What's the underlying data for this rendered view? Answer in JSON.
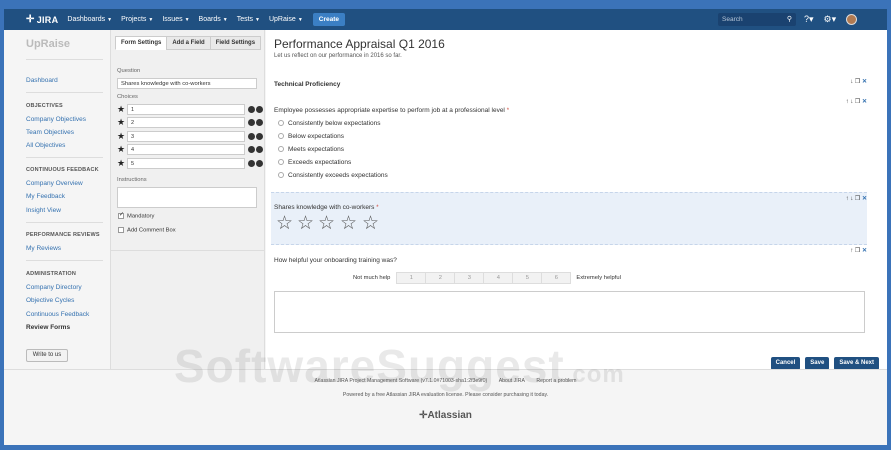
{
  "nav": {
    "logo": "JIRA",
    "items": [
      "Dashboards",
      "Projects",
      "Issues",
      "Boards",
      "Tests",
      "UpRaise"
    ],
    "create": "Create",
    "search_placeholder": "Search"
  },
  "sidebar": {
    "title": "UpRaise",
    "dashboard": "Dashboard",
    "sections": [
      {
        "heading": "OBJECTIVES",
        "items": [
          "Company Objectives",
          "Team Objectives",
          "All Objectives"
        ]
      },
      {
        "heading": "CONTINUOUS FEEDBACK",
        "items": [
          "Company Overview",
          "My Feedback",
          "Insight View"
        ]
      },
      {
        "heading": "PERFORMANCE REVIEWS",
        "items": [
          "My Reviews"
        ]
      },
      {
        "heading": "ADMINISTRATION",
        "items": [
          "Company Directory",
          "Objective Cycles",
          "Continuous Feedback",
          "Review Forms"
        ]
      }
    ],
    "write_button": "Write to us"
  },
  "panel": {
    "tabs": [
      "Form Settings",
      "Add a Field",
      "Field Settings"
    ],
    "question_label": "Question",
    "question_value": "Shares knowledge with co-workers",
    "choices_label": "Choices",
    "choices": [
      "1",
      "2",
      "3",
      "4",
      "5"
    ],
    "instructions_label": "Instructions",
    "mandatory": "Mandatory",
    "comment_box": "Add Comment Box"
  },
  "form": {
    "title": "Performance Appraisal Q1 2016",
    "subtitle": "Let us reflect on our performance in 2016 so far.",
    "section_title": "Technical Proficiency",
    "q1": {
      "text": "Employee possesses appropriate expertise to perform job at a professional level",
      "req": "*",
      "options": [
        "Consistently below expectations",
        "Below expectations",
        "Meets expectations",
        "Exceeds expectations",
        "Consistently exceeds expectations"
      ]
    },
    "q2": {
      "text": "Shares knowledge with co-workers",
      "req": "*"
    },
    "q3": {
      "text": "How helpful your onboarding training was?",
      "low": "Not much help",
      "high": "Extremely helpful",
      "scale": [
        "1",
        "2",
        "3",
        "4",
        "5",
        "6"
      ]
    },
    "buttons": {
      "cancel": "Cancel",
      "save": "Save",
      "save_next": "Save & Next"
    }
  },
  "footer": {
    "line1": [
      "Atlassian JIRA Project Management Software (v7.1.0#71003-sha1:2f3e9f0)",
      "About JIRA",
      "Report a problem"
    ],
    "line2": "Powered by a free Atlassian JIRA evaluation license. Please consider purchasing it today.",
    "logo": "Atlassian"
  },
  "watermark": {
    "main": "SoftwareSuggest",
    "tld": ".com"
  }
}
